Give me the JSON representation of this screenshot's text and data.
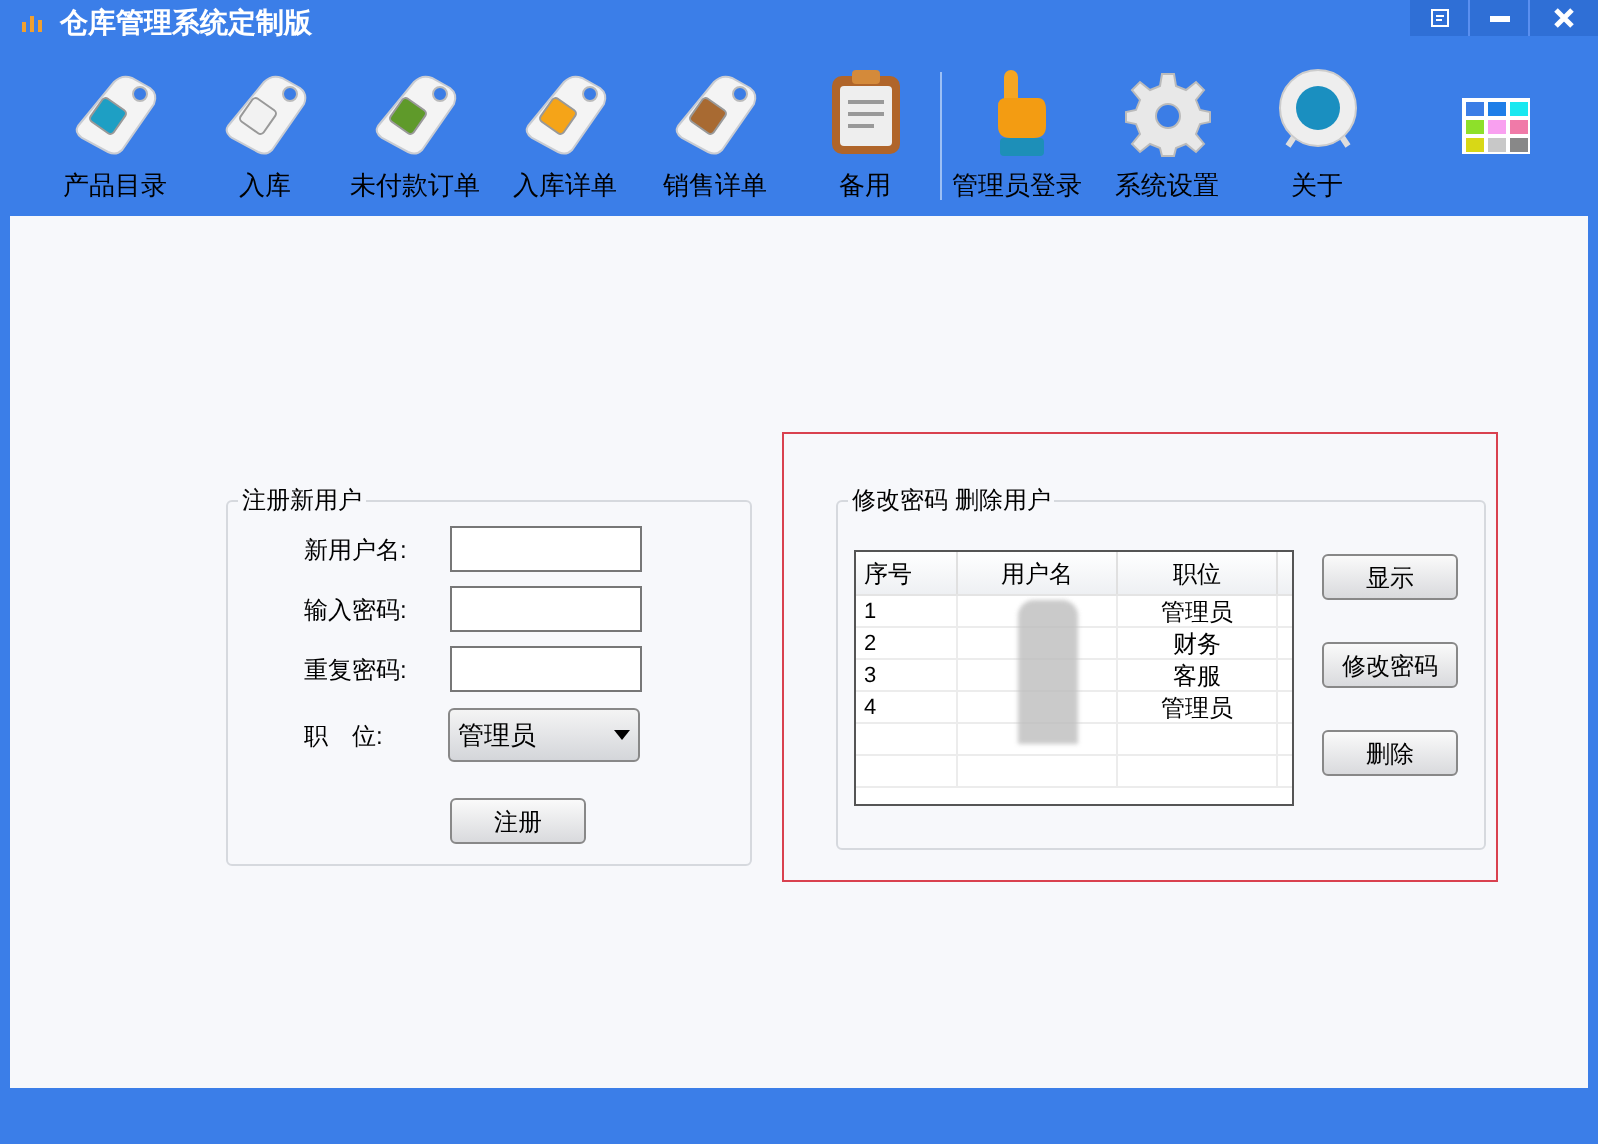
{
  "window": {
    "title": "仓库管理系统定制版"
  },
  "toolbar": [
    {
      "kind": "tag",
      "label": "产品目录",
      "color": "#1e9fc4"
    },
    {
      "kind": "tag",
      "label": "入库",
      "color": "#f2f2f2"
    },
    {
      "kind": "tag",
      "label": "未付款订单",
      "color": "#5f9a2a"
    },
    {
      "kind": "tag",
      "label": "入库详单",
      "color": "#f5a418"
    },
    {
      "kind": "tag",
      "label": "销售详单",
      "color": "#a86a32"
    },
    {
      "kind": "clipboard",
      "label": "备用"
    },
    {
      "kind": "separator"
    },
    {
      "kind": "hand",
      "label": "管理员登录"
    },
    {
      "kind": "gear",
      "label": "系统设置"
    },
    {
      "kind": "globe",
      "label": "关于"
    }
  ],
  "register": {
    "title": "注册新用户",
    "fields": [
      {
        "label": "新用户名:"
      },
      {
        "label": "输入密码:"
      },
      {
        "label": "重复密码:"
      }
    ],
    "role": {
      "label": "职　位:",
      "value": "管理员"
    },
    "button": "注册"
  },
  "manage": {
    "title": "修改密码 删除用户",
    "highlighted": true,
    "table": {
      "columns": [
        "序号",
        "用户名",
        "职位"
      ],
      "rows": [
        {
          "index": "1",
          "role": "管理员"
        },
        {
          "index": "2",
          "role": "财务"
        },
        {
          "index": "3",
          "role": "客服"
        },
        {
          "index": "4",
          "role": "管理员"
        }
      ]
    },
    "buttons": [
      "显示",
      "修改密码",
      "删除"
    ]
  }
}
